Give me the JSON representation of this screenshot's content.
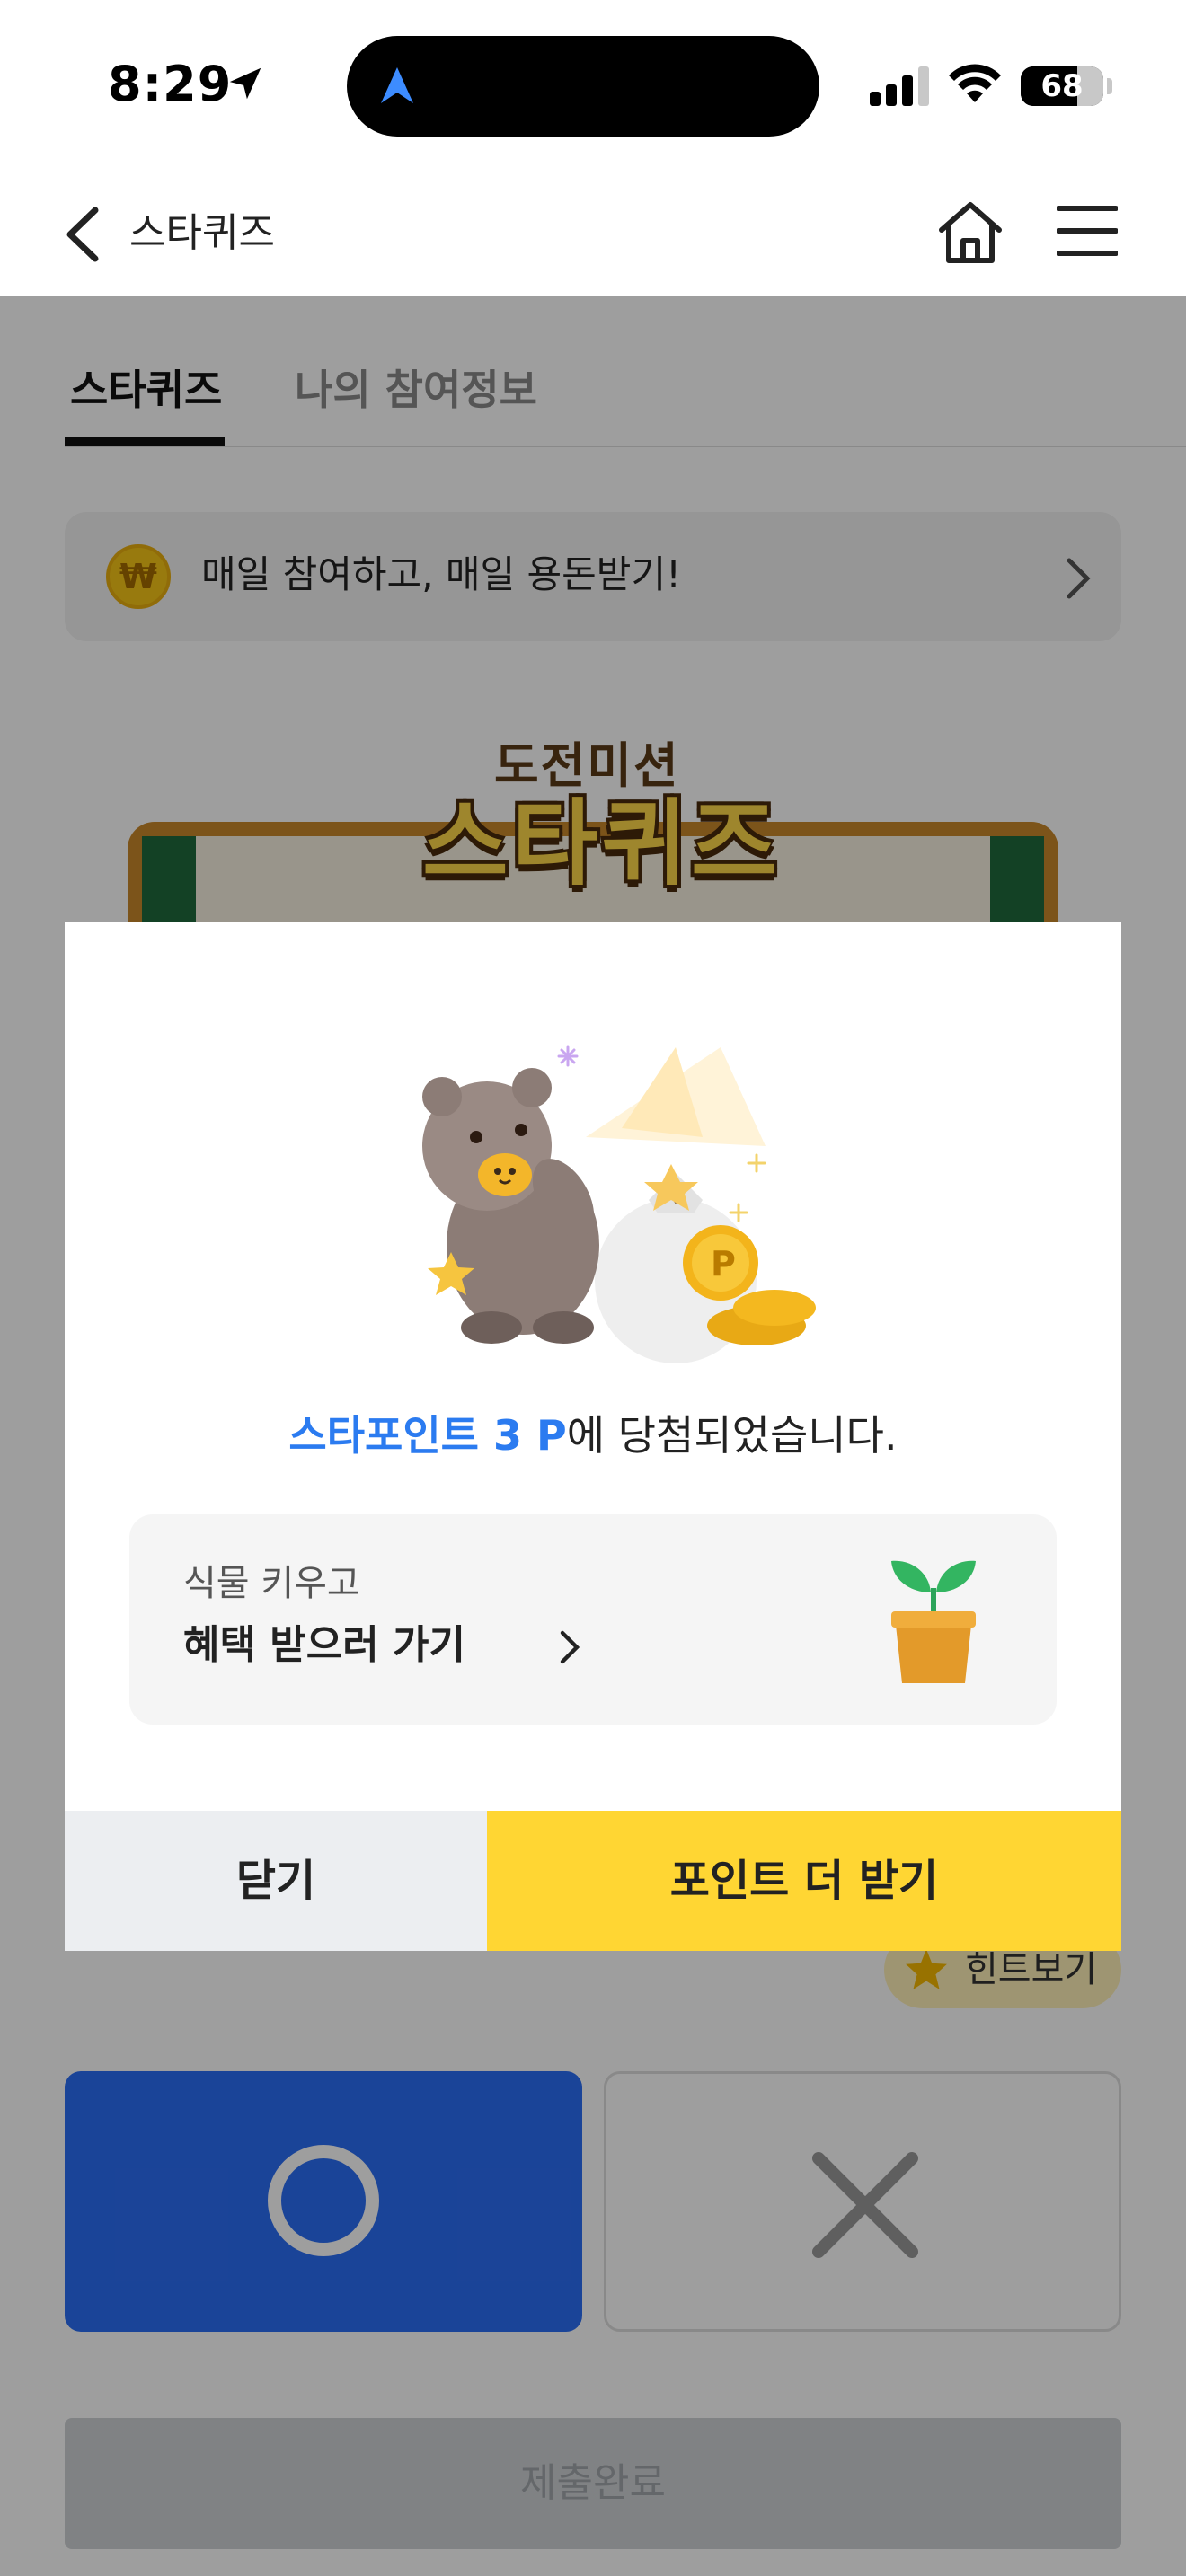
{
  "status_bar": {
    "time": "8:29",
    "battery": "68",
    "battery_level": 0.68
  },
  "header": {
    "title": "스타퀴즈",
    "back_icon": "chevron-left-icon",
    "home_icon": "home-icon",
    "menu_icon": "hamburger-menu-icon"
  },
  "tabs": [
    {
      "label": "스타퀴즈",
      "active": true
    },
    {
      "label": "나의 참여정보",
      "active": false
    }
  ],
  "banner": {
    "coin_symbol": "₩",
    "text": "매일 참여하고, 매일 용돈받기!"
  },
  "quiz_logo": {
    "top": "도전미션",
    "main": "스타퀴즈"
  },
  "hint": {
    "label": "힌트보기"
  },
  "answers": {
    "o_label": "O",
    "x_label": "X"
  },
  "submit": {
    "label": "제출완료"
  },
  "modal": {
    "prize_highlight": "스타포인트 3 P",
    "prize_suffix": "에 당첨되었습니다.",
    "plant_card": {
      "subtitle": "식물 키우고",
      "title": "혜택 받으러 가기"
    },
    "close_label": "닫기",
    "more_label": "포인트 더 받기"
  },
  "colors": {
    "accent_blue": "#2b7bf0",
    "yellow_button": "#ffd633",
    "o_button": "#2b6ef5"
  }
}
